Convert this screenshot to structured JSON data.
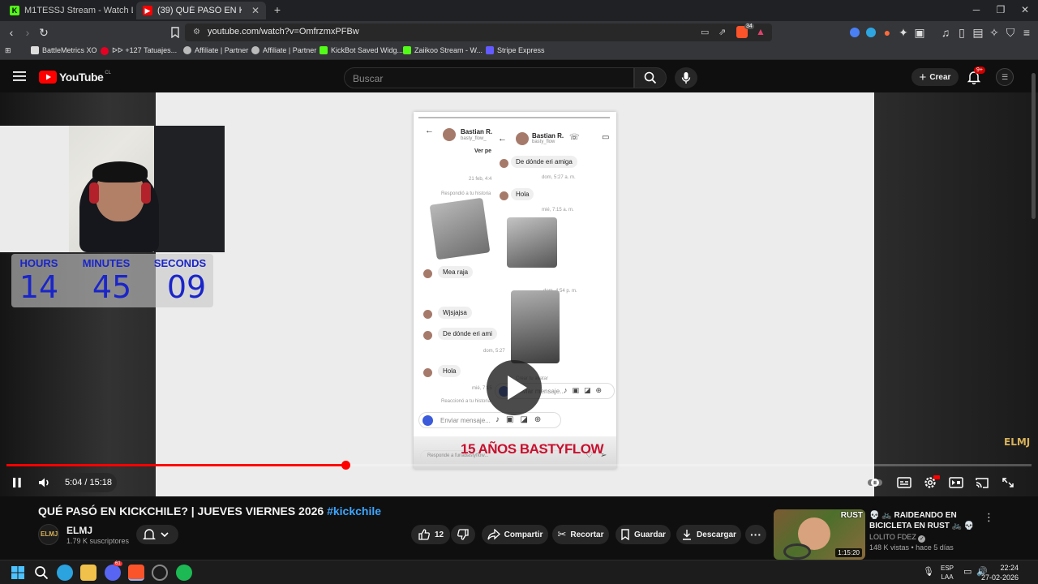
{
  "browser": {
    "tabs": [
      {
        "label": "M1TESSJ Stream - Watch Live on Kick",
        "active": false
      },
      {
        "label": "(39) QUÉ PASÓ EN KICKCHILE",
        "active": true
      }
    ],
    "new_tab": "+",
    "url": "youtube.com/watch?v=OmfrzmxPFBw",
    "bookmarks": [
      "BattleMetrics XO",
      "ᐅᐅ +127 Tatuajes...",
      "Affiliate | Partner",
      "Affiliate | Partner",
      "KickBot Saved Widg...",
      "Zaiikoo Stream - W...",
      "Stripe Express"
    ],
    "extension_badge": "34"
  },
  "youtube": {
    "logo_text": "YouTube",
    "region": "CL",
    "search_placeholder": "Buscar",
    "create_label": "Crear",
    "notif_count": "9+"
  },
  "overlay": {
    "timer_labels": [
      "HOURS",
      "MINUTES",
      "SECONDS"
    ],
    "timer_values": [
      "14",
      "45",
      "09"
    ],
    "phone_messages": {
      "name1": "Bastian R.",
      "handle1": "basty_flow_",
      "name2": "Bastian R.",
      "handle2": "basty_flow",
      "ver": "Ver pe",
      "q1": "De dónde eri amiga",
      "date1": "21 feb, 4:4",
      "meta1": "dom, 5:27 a. m.",
      "reply": "Respondió a tu historia",
      "hola1": "Hola",
      "meta2": "mié, 7:15 a. m.",
      "mea": "Mea raja",
      "meta3": "dom, 4:54 p. m.",
      "wjs": "Wjsjajsa",
      "q2": "De dónde eri ami",
      "meta4": "dom, 5:27",
      "hola2": "Hola",
      "meta5": "mié, 7:15",
      "react": "Reaccionó a tu historia",
      "avatar": "Crear tu avatar",
      "send1": "Enviar mensaje...",
      "send2": "Enviar mensaje...",
      "reply_to": "Responde a funabastyflow..."
    },
    "banner": "15 AÑOS BASTYFLOW",
    "watermark": "ELMJ"
  },
  "player": {
    "time": "5:04 / 15:18",
    "progress": 0.331
  },
  "video": {
    "title": "QUÉ PASÓ EN KICKCHILE? | JUEVES VIERNES 2026",
    "hashtag": "#kickchile",
    "channel": "ELMJ",
    "subscribers": "1.79 K suscriptores",
    "likes": "12",
    "share": "Compartir",
    "clip": "Recortar",
    "save": "Guardar",
    "download": "Descargar"
  },
  "recommendation": {
    "title": "💀 🚲 RAIDEANDO EN BICICLETA EN RUST 🚲 💀",
    "channel": "LOLITO FDEZ",
    "stats": "148 K vistas • hace 5 días",
    "duration": "1:15:20",
    "thumb_label": "RUST"
  },
  "taskbar": {
    "lang1": "ESP",
    "lang2": "LAA",
    "time": "22:24",
    "date": "27-02-2026",
    "discord_badge": "61"
  }
}
